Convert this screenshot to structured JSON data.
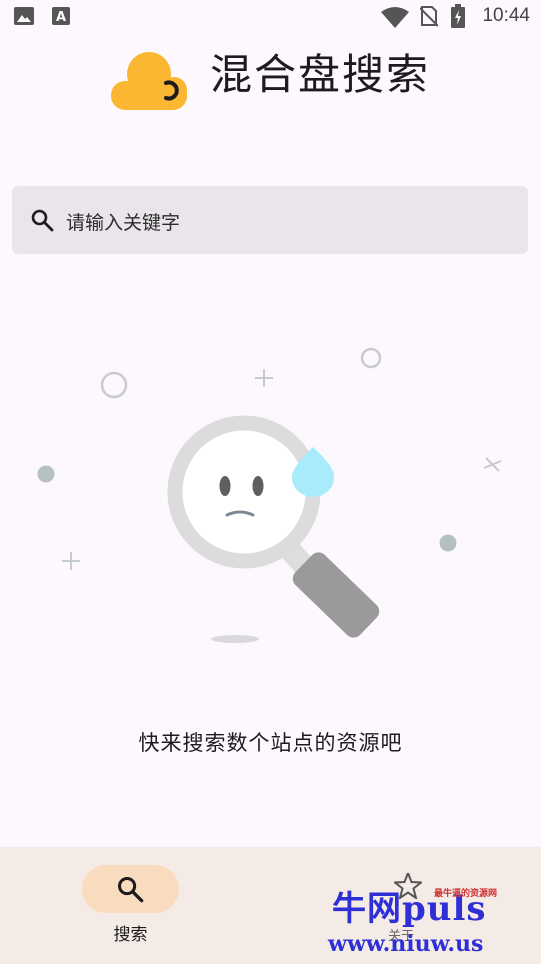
{
  "status_bar": {
    "time": "10:44",
    "icons": [
      "image-icon",
      "text-icon",
      "wifi-icon",
      "no-sim-icon",
      "battery-charging-icon"
    ]
  },
  "header": {
    "title": "混合盘搜索",
    "logo": "cloud-logo-icon"
  },
  "search": {
    "placeholder": "请输入关键字",
    "icon": "search-icon"
  },
  "empty_state": {
    "illustration": "sad-magnifier-illustration",
    "message": "快来搜索数个站点的资源吧"
  },
  "bottom_nav": {
    "items": [
      {
        "label": "搜索",
        "icon": "search-icon",
        "active": true
      },
      {
        "label": "关于",
        "icon": "info-icon",
        "active": false
      }
    ]
  },
  "watermark": {
    "title": "牛网puls",
    "subtitle": "最牛逼的资源网",
    "url": "www.niuw.us"
  },
  "colors": {
    "background": "#fdf8fd",
    "search_bg": "#e9e5ea",
    "nav_bg": "#f4ebe6",
    "nav_active": "#f9dcbf",
    "logo": "#fbb731",
    "drop": "#a8ecfb"
  }
}
